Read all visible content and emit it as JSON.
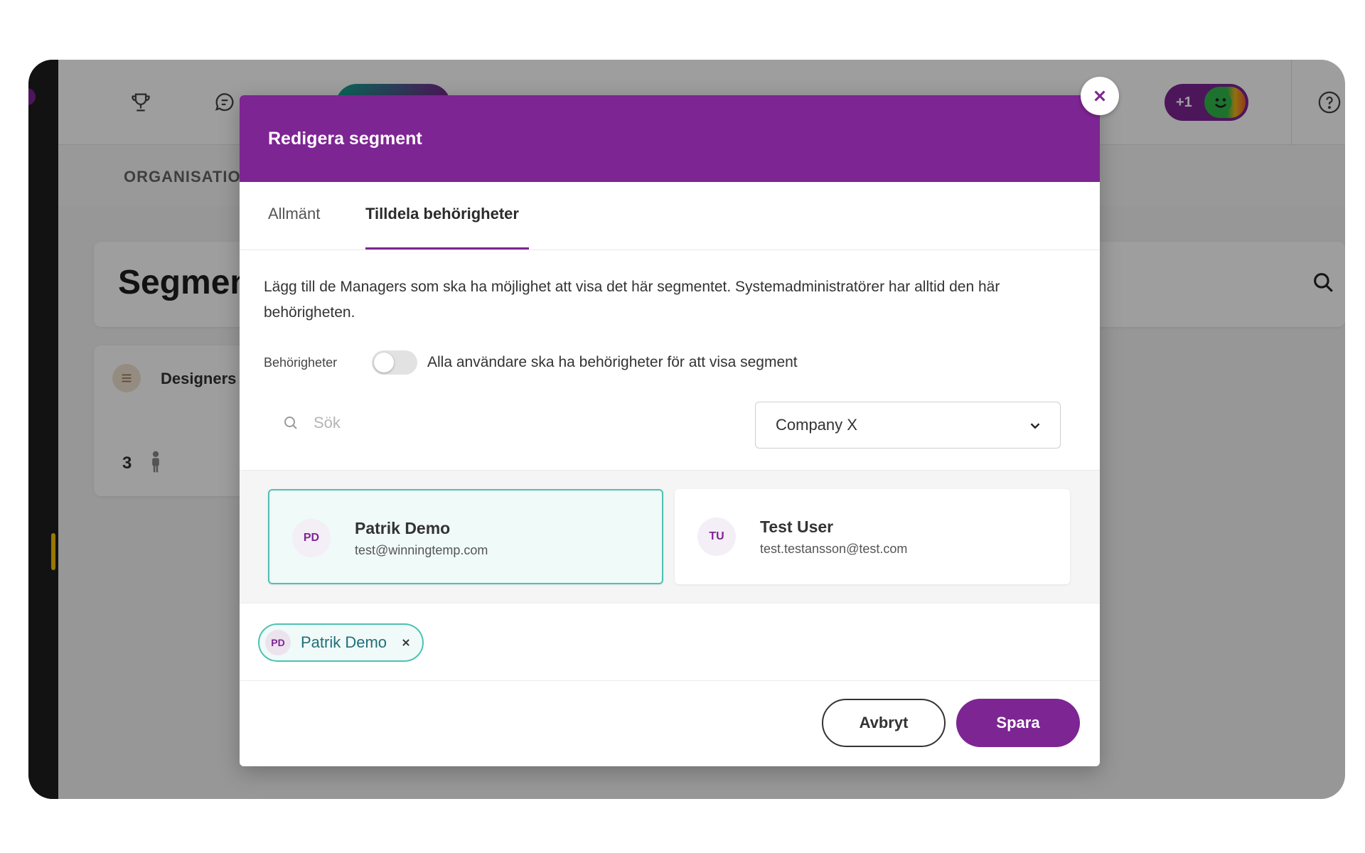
{
  "background": {
    "subheader_label": "ORGANISATION",
    "segments_title": "Segmen",
    "segment_card": {
      "name": "Designers",
      "member_count": "3"
    },
    "mood_badge": "+1"
  },
  "modal": {
    "title": "Redigera segment",
    "tabs": [
      {
        "label": "Allmänt",
        "active": false
      },
      {
        "label": "Tilldela behörigheter",
        "active": true
      }
    ],
    "description": "Lägg till de Managers som ska ha möjlighet att visa det här segmentet. Systemadministratörer har alltid den här behörigheten.",
    "permissions": {
      "label": "Behörigheter",
      "toggle_on": false,
      "toggle_text": "Alla användare ska ha behörigheter för att visa segment"
    },
    "search": {
      "placeholder": "Sök",
      "value": ""
    },
    "company_select": {
      "value": "Company X"
    },
    "users": [
      {
        "initials": "PD",
        "name": "Patrik Demo",
        "email": "test@winningtemp.com",
        "selected": true
      },
      {
        "initials": "TU",
        "name": "Test User",
        "email": "test.testansson@test.com",
        "selected": false
      }
    ],
    "selected_chips": [
      {
        "initials": "PD",
        "name": "Patrik Demo"
      }
    ],
    "buttons": {
      "cancel": "Avbryt",
      "save": "Spara"
    }
  },
  "colors": {
    "brand_purple": "#7d2593",
    "selected_teal": "#4ec1b4",
    "rail_accent": "#f5c400"
  }
}
